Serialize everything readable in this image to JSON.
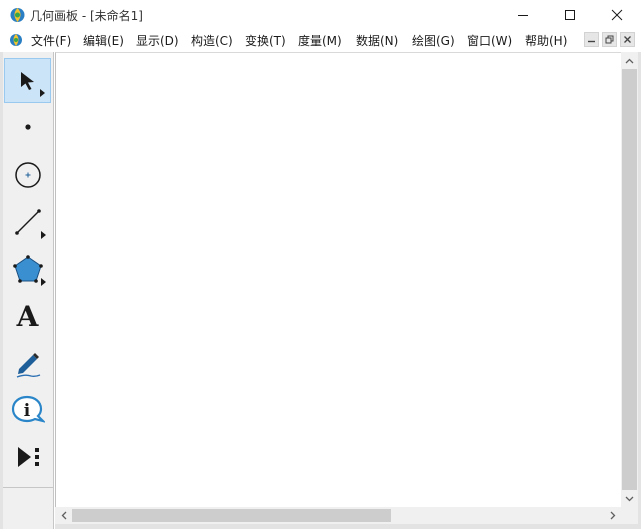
{
  "window": {
    "title": "几何画板 - [未命名1]",
    "minimize_icon": "minimize-icon",
    "maximize_icon": "maximize-icon",
    "close_icon": "close-icon"
  },
  "menu": {
    "items": [
      "文件(F)",
      "编辑(E)",
      "显示(D)",
      "构造(C)",
      "变换(T)",
      "度量(M)",
      "数据(N)",
      "绘图(G)",
      "窗口(W)",
      "帮助(H)"
    ]
  },
  "toolbox": {
    "tools": [
      {
        "name": "arrow-select-tool",
        "icon": "cursor-arrow-icon",
        "selected": true,
        "has_submenu": true
      },
      {
        "name": "point-tool",
        "icon": "point-icon",
        "selected": false,
        "has_submenu": false
      },
      {
        "name": "compass-tool",
        "icon": "circle-icon",
        "selected": false,
        "has_submenu": false
      },
      {
        "name": "straightedge-tool",
        "icon": "line-segment-icon",
        "selected": false,
        "has_submenu": true
      },
      {
        "name": "polygon-tool",
        "icon": "pentagon-icon",
        "selected": false,
        "has_submenu": true
      },
      {
        "name": "text-tool",
        "icon": "text-a-icon",
        "selected": false,
        "has_submenu": false
      },
      {
        "name": "marker-tool",
        "icon": "marker-pen-icon",
        "selected": false,
        "has_submenu": false
      },
      {
        "name": "information-tool",
        "icon": "info-icon",
        "selected": false,
        "has_submenu": false
      },
      {
        "name": "custom-tools",
        "icon": "custom-tool-icon",
        "selected": false,
        "has_submenu": false
      }
    ],
    "text_tool_glyph": "A",
    "info_tool_glyph": "i"
  },
  "colors": {
    "selected_tool_bg": "#cce4f7",
    "polygon_fill": "#3a8fd0",
    "marker_pen": "#1e5f99",
    "scrollbar_thumb": "#cdcdcd"
  }
}
